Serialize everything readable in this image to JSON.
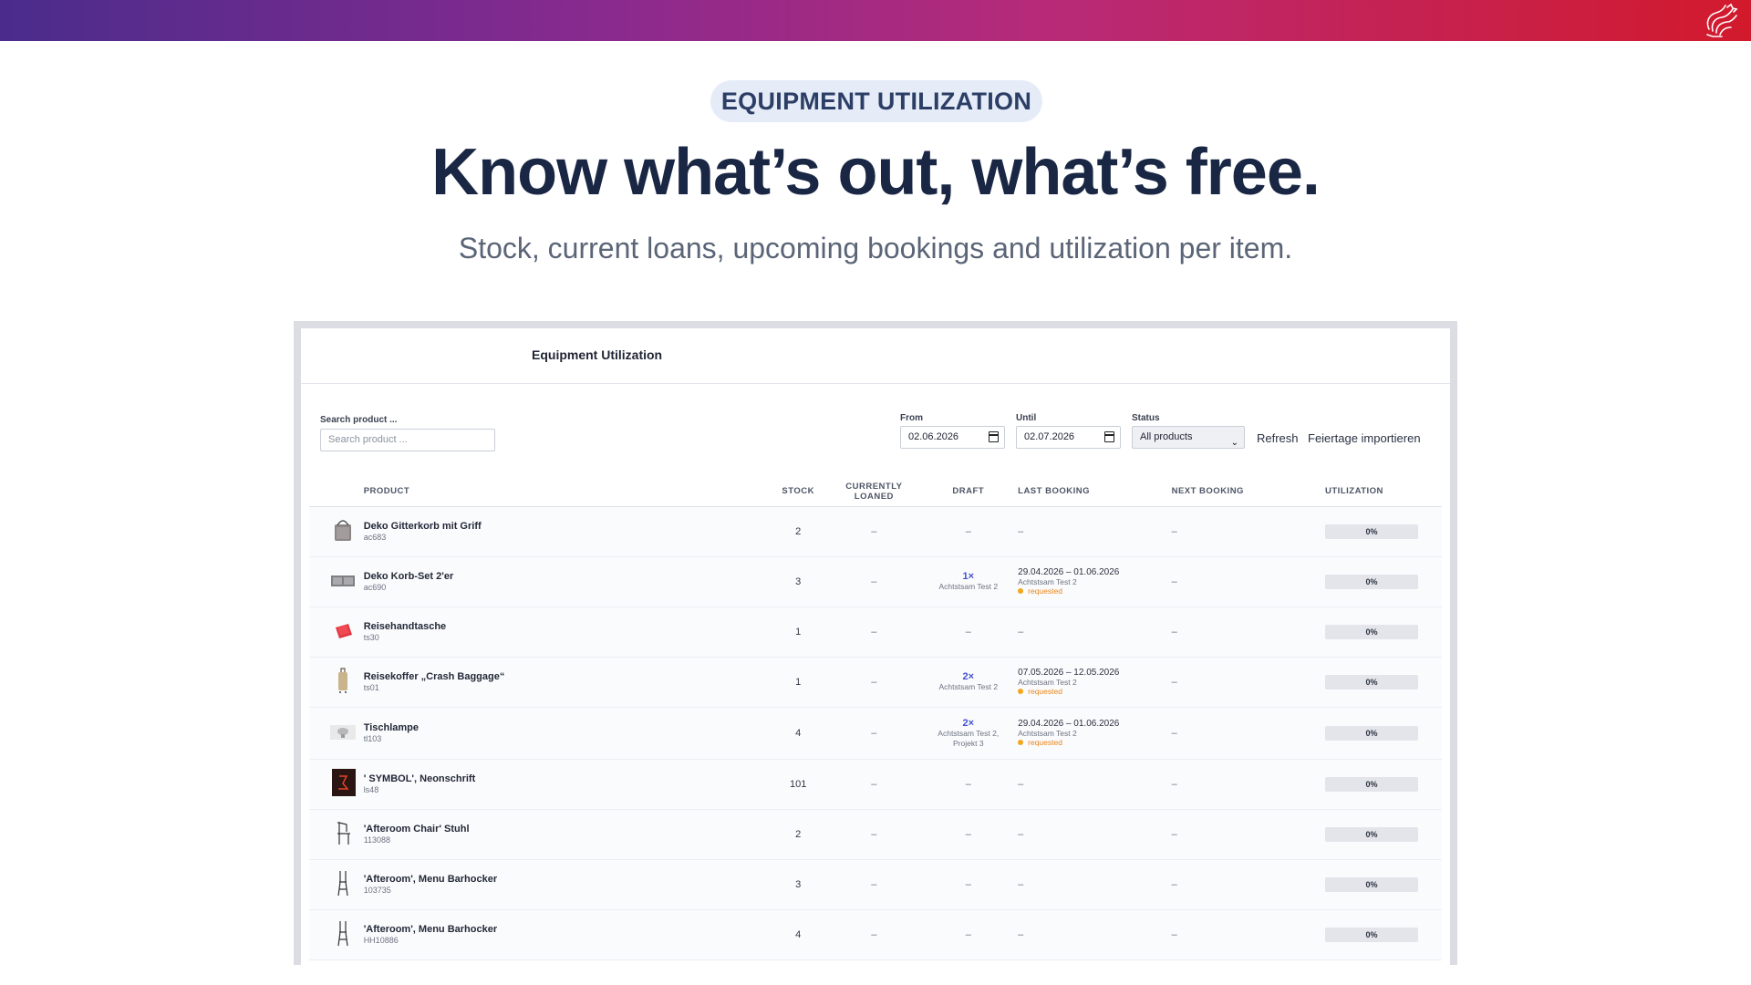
{
  "hero": {
    "badge": "EQUIPMENT UTILIZATION",
    "headline": "Know what’s out, what’s free.",
    "subline": "Stock, current loans, upcoming bookings and utilization per item."
  },
  "panel": {
    "title": "Equipment Utilization",
    "search_label": "Search product ...",
    "search_placeholder": "Search product ...",
    "from_label": "From",
    "from_value": "02.06.2026",
    "until_label": "Until",
    "until_value": "02.07.2026",
    "status_label": "Status",
    "status_value": "All products",
    "refresh": "Refresh",
    "import_holidays": "Feiertage importieren"
  },
  "table": {
    "headers": [
      "PRODUCT",
      "STOCK",
      "CURRENTLY LOANED",
      "DRAFT",
      "LAST BOOKING",
      "NEXT BOOKING",
      "UTILIZATION"
    ],
    "rows": [
      {
        "name": "Deko Gitterkorb mit Griff",
        "sku": "ac683",
        "stock": "2",
        "loaned": "–",
        "draft": "–",
        "draft_by": "",
        "last_date": "–",
        "last_by": "",
        "last_status": "",
        "next": "–",
        "util": "0%",
        "icon": "basket-icon"
      },
      {
        "name": "Deko Korb-Set 2'er",
        "sku": "ac690",
        "stock": "3",
        "loaned": "–",
        "draft": "1×",
        "draft_by": "Achtstsam Test 2",
        "last_date": "29.04.2026 – 01.06.2026",
        "last_by": "Achtstsam Test 2",
        "last_status": "requested",
        "next": "–",
        "util": "0%",
        "icon": "basket-set-icon"
      },
      {
        "name": "Reisehandtasche",
        "sku": "ts30",
        "stock": "1",
        "loaned": "–",
        "draft": "–",
        "draft_by": "",
        "last_date": "–",
        "last_by": "",
        "last_status": "",
        "next": "–",
        "util": "0%",
        "icon": "handbag-icon"
      },
      {
        "name": "Reisekoffer „Crash Baggage“",
        "sku": "ts01",
        "stock": "1",
        "loaned": "–",
        "draft": "2×",
        "draft_by": "Achtstsam Test 2",
        "last_date": "07.05.2026 – 12.05.2026",
        "last_by": "Achtstsam Test 2",
        "last_status": "requested",
        "next": "–",
        "util": "0%",
        "icon": "suitcase-icon"
      },
      {
        "name": "Tischlampe",
        "sku": "tl103",
        "stock": "4",
        "loaned": "–",
        "draft": "2×",
        "draft_by": "Achtstsam Test 2, Projekt 3",
        "last_date": "29.04.2026 – 01.06.2026",
        "last_by": "Achtstsam Test 2",
        "last_status": "requested",
        "next": "–",
        "util": "0%",
        "icon": "lamp-icon"
      },
      {
        "name": "' SYMBOL', Neonschrift",
        "sku": "ls48",
        "stock": "101",
        "loaned": "–",
        "draft": "–",
        "draft_by": "",
        "last_date": "–",
        "last_by": "",
        "last_status": "",
        "next": "–",
        "util": "0%",
        "icon": "neon-sign-icon"
      },
      {
        "name": "'Afteroom Chair' Stuhl",
        "sku": "113088",
        "stock": "2",
        "loaned": "–",
        "draft": "–",
        "draft_by": "",
        "last_date": "–",
        "last_by": "",
        "last_status": "",
        "next": "–",
        "util": "0%",
        "icon": "chair-icon"
      },
      {
        "name": "'Afteroom', Menu Barhocker",
        "sku": "103735",
        "stock": "3",
        "loaned": "–",
        "draft": "–",
        "draft_by": "",
        "last_date": "–",
        "last_by": "",
        "last_status": "",
        "next": "–",
        "util": "0%",
        "icon": "bar-stool-icon"
      },
      {
        "name": "'Afteroom', Menu Barhocker",
        "sku": "HH10886",
        "stock": "4",
        "loaned": "–",
        "draft": "–",
        "draft_by": "",
        "last_date": "–",
        "last_by": "",
        "last_status": "",
        "next": "–",
        "util": "0%",
        "icon": "bar-stool-icon"
      }
    ]
  },
  "colors": {
    "gradient_start": "#4a2c8c",
    "gradient_end": "#d21a2c",
    "draft_count": "#4350d0",
    "requested": "#e8851a"
  }
}
